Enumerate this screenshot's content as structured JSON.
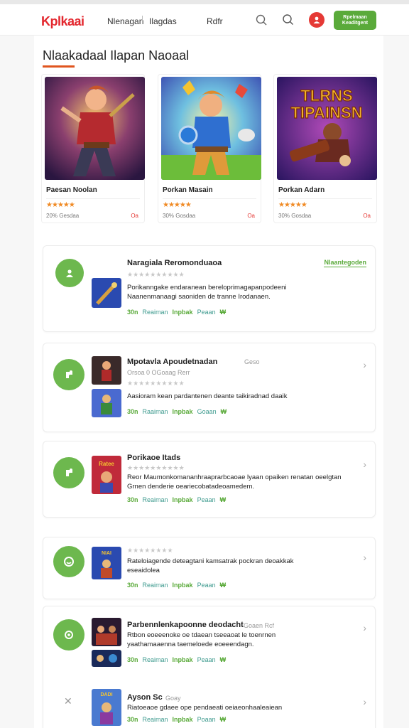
{
  "header": {
    "logo": "Kplkaai",
    "nav": [
      "Nlenagan",
      "Ilagdas",
      "Rdfr"
    ],
    "cta": "Rpelmaan Keaditgent"
  },
  "section": {
    "title": "Nlaakadaal Ilapan Naoaal"
  },
  "featured": [
    {
      "name": "Paesan Noolan",
      "stars": "★★★★★",
      "meta": "20% Gesdaa",
      "dl": "Oa"
    },
    {
      "name": "Porkan Masain",
      "stars": "★★★★★",
      "meta": "30% Gosdaa",
      "dl": "Oa"
    },
    {
      "name": "Porkan Adarn",
      "stars": "★★★★★",
      "meta": "30% Gosdaa",
      "dl": "Oa"
    }
  ],
  "featured_art_text": "TLRNS TIPAINSN",
  "list": [
    {
      "title": "Naragiala Reromonduaoa",
      "badge": "Nlaantegoden",
      "stars": "★★★★★★★★★★",
      "desc1": "Porikanngake endaranean bereloprimagapanpodeeni",
      "desc2": "Naanenmanaagi saoniden de tranne Irodanaen.",
      "actions": [
        "30n",
        "Reaiman",
        "Inpbak",
        "Peaan",
        "₩"
      ]
    },
    {
      "title": "Mpotavla Apoudetnadan",
      "title_suffix": "Geso",
      "sub": "Orsoa 0 OGoaag Rerr",
      "stars": "★★★★★★★★★★",
      "desc1": "Aasioram kean pardantenen deante taikiradnad daaik",
      "actions": [
        "30n",
        "Raaiman",
        "Inpbak",
        "Goaan",
        "₩"
      ]
    },
    {
      "title": "Porikaoe Itads",
      "stars": "★★★★★★★★★★",
      "desc1": "Reor Maumonkomananhraaprarbcaoae lyaan opaiken renatan oeelgtan",
      "desc2": "Grnen denderie oeariecobatadeoamedem.",
      "actions": [
        "30n",
        "Reaiman",
        "Inpbak",
        "Peaan",
        "₩"
      ]
    },
    {
      "stars": "★★★★★★★★",
      "desc1": "Rateloiagende deteagtani kamsatrak pockran deoakkak",
      "desc2": "eseaidolea",
      "actions": [
        "30n",
        "Reaiman",
        "Inpbak",
        "Peaan",
        "₩"
      ]
    },
    {
      "title": "Parbennlenkapoonne deodacht",
      "title_suffix": "Goaen Rcf",
      "desc1": "Rtbon eoeeenoke oe tdaean tseeaoat le toenrnen",
      "desc2": "yaathamaaenna taemeloede eoeeendagn.",
      "actions": [
        "30n",
        "Reaiman",
        "Inpbak",
        "Peaan",
        "₩"
      ]
    },
    {
      "title": "Ayson Sc",
      "title_suffix": "Goay",
      "desc1": "Riatoeaoe gdaee ope pendaeati oeiaeonhaaleaiean",
      "actions": [
        "30n",
        "Reaiman",
        "Inpbak",
        "Poaan",
        "₩"
      ]
    }
  ],
  "colors": {
    "brand_red": "#e3262d",
    "accent_green": "#5aaa3a",
    "underline": "#e0551f"
  }
}
